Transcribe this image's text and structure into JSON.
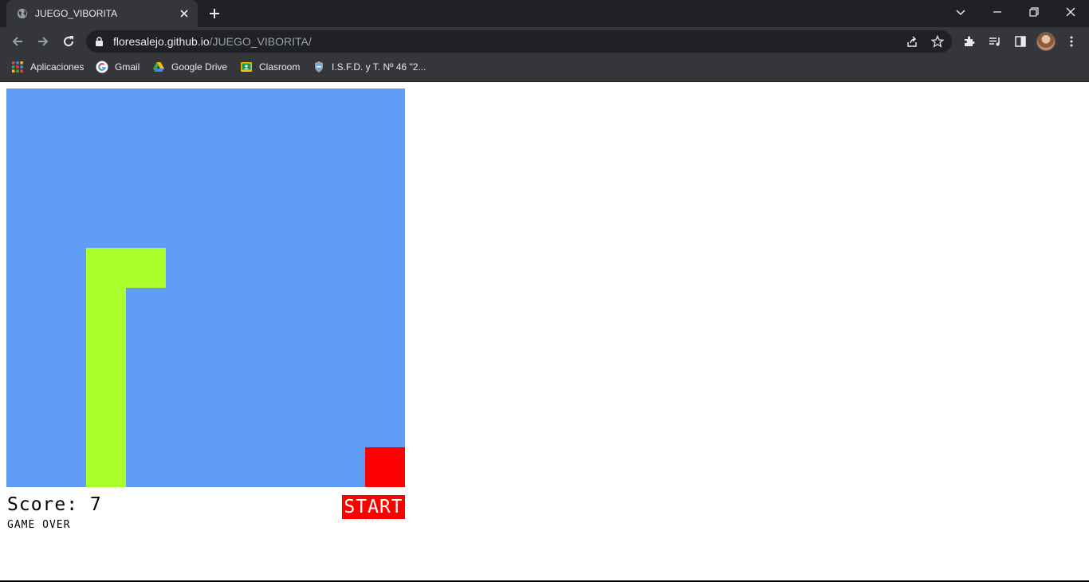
{
  "browser": {
    "tab_title": "JUEGO_VIBORITA",
    "url_host": "floresalejo.github.io",
    "url_path": "/JUEGO_VIBORITA/",
    "bookmarks": [
      {
        "label": "Aplicaciones",
        "icon": "apps-grid-icon"
      },
      {
        "label": "Gmail",
        "icon": "google-g-icon"
      },
      {
        "label": "Google Drive",
        "icon": "google-drive-icon"
      },
      {
        "label": "Clasroom",
        "icon": "classroom-icon"
      },
      {
        "label": "I.S.F.D. y T. Nº 46 \"2...",
        "icon": "isfd-shield-icon"
      }
    ]
  },
  "game": {
    "score_label": "Score: 7",
    "status": "GAME OVER",
    "start_label": "START",
    "grid_cells": 10,
    "colors": {
      "board": "#619cf7",
      "snake": "#aaff2b",
      "food": "#ff0000",
      "start_button": "#ff0000"
    },
    "snake": [
      [
        3,
        4
      ],
      [
        2,
        4
      ],
      [
        2,
        5
      ],
      [
        2,
        6
      ],
      [
        2,
        7
      ],
      [
        2,
        8
      ],
      [
        2,
        9
      ]
    ],
    "food": [
      9,
      9
    ]
  }
}
